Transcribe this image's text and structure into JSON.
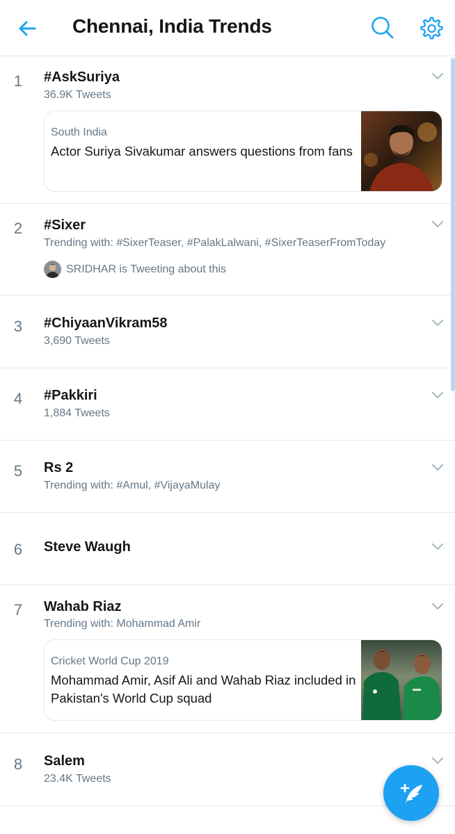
{
  "header": {
    "title": "Chennai, India Trends",
    "back_icon": "arrow-left-icon",
    "search_icon": "search-icon",
    "settings_icon": "gear-icon"
  },
  "colors": {
    "accent": "#1da1f2",
    "text": "#14171a",
    "secondary": "#657786",
    "divider": "#e1e8ed"
  },
  "trends": [
    {
      "rank": "1",
      "name": "#AskSuriya",
      "meta": "36.9K Tweets",
      "card": {
        "context": "South India",
        "headline": "Actor Suriya Sivakumar answers questions from fans"
      }
    },
    {
      "rank": "2",
      "name": "#Sixer",
      "meta": "Trending with: #SixerTeaser, #PalakLalwani, #SixerTeaserFromToday",
      "tweeting": "SRIDHAR is Tweeting about this"
    },
    {
      "rank": "3",
      "name": "#ChiyaanVikram58",
      "meta": "3,690 Tweets"
    },
    {
      "rank": "4",
      "name": "#Pakkiri",
      "meta": "1,884 Tweets"
    },
    {
      "rank": "5",
      "name": "Rs 2",
      "meta": "Trending with: #Amul, #VijayaMulay"
    },
    {
      "rank": "6",
      "name": "Steve Waugh"
    },
    {
      "rank": "7",
      "name": "Wahab Riaz",
      "meta": "Trending with: Mohammad Amir",
      "card": {
        "context": "Cricket World Cup 2019",
        "headline": "Mohammad Amir, Asif Ali and Wahab Riaz included in Pakistan's World Cup squad"
      }
    },
    {
      "rank": "8",
      "name": "Salem",
      "meta": "23.4K Tweets"
    }
  ],
  "fab": {
    "icon": "compose-tweet-icon"
  }
}
